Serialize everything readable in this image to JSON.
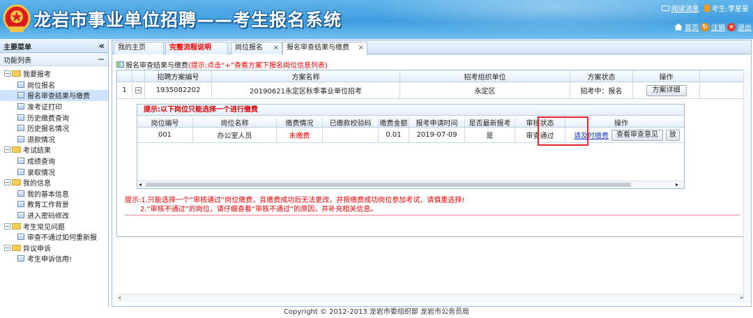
{
  "header": {
    "title": "龙岩市事业单位招聘——考生报名系统",
    "read_msg": "阅读消息",
    "candidate_label": "考生:李星星",
    "home": "首页",
    "logout": "注销",
    "exit": "退出"
  },
  "sidebar": {
    "main_menu": "主要菜单",
    "collapse_glyph": "«",
    "func_list": "功能列表",
    "minus_glyph": "−",
    "groups": [
      {
        "label": "我要报考",
        "items": [
          "岗位报名",
          "报名审查结果与缴费",
          "准考证打印",
          "历史缴费查询",
          "历史报名情况",
          "退款情况"
        ]
      },
      {
        "label": "考试结果",
        "items": [
          "成绩查询",
          "录取情况"
        ]
      },
      {
        "label": "我的信息",
        "items": [
          "我的基本信息",
          "教育工作背景",
          "进入密码修改"
        ]
      },
      {
        "label": "考生常见问题",
        "items": [
          "审查不通过如何重新报"
        ]
      },
      {
        "label": "异议申诉",
        "items": [
          "考生申诉信用!"
        ]
      }
    ]
  },
  "tabs": [
    {
      "label": "我的主页",
      "closable": false
    },
    {
      "label": "完整流程说明",
      "closable": false
    },
    {
      "label": "岗位报名",
      "closable": true
    },
    {
      "label": "报名审查结果与缴费",
      "closable": true
    }
  ],
  "panel": {
    "title": "报名审查结果与缴费",
    "hint": "(提示:点击“+”查看方案下报名岗位信息列表)"
  },
  "grid": {
    "columns": [
      "招聘方案编号",
      "方案名称",
      "招考组织单位",
      "方案状态",
      "操作"
    ],
    "row": {
      "index": "1",
      "expand_glyph": "−",
      "code": "1935082202",
      "name": "20190621永定区秋季事业单位招考",
      "org": "永定区",
      "status": "招考中：报名",
      "action": "方案详细"
    }
  },
  "subgrid": {
    "title": "提示:以下岗位只能选择一个进行缴费",
    "columns": [
      "岗位编号",
      "岗位名称",
      "缴费情况",
      "已缴款校验码",
      "缴费金额",
      "报考申请时间",
      "是否最新报考",
      "审核状态",
      "操作"
    ],
    "row": {
      "post_code": "001",
      "post_name": "办公室人员",
      "pay_status": "未缴费",
      "verify_code": "",
      "amount": "0.01",
      "apply_time": "2019-07-09",
      "is_latest": "是",
      "audit": "审查通过",
      "pay_link": "请及时缴费",
      "view_btn": "查看审查意见",
      "more_btn": "放"
    }
  },
  "notes": {
    "line1": "提示:1.只能选择一个“审核通过”岗位缴费，且缴费成功后无法更改，并按缴费成功岗位参加考试，请慎重选择!",
    "line2": "2.“审核不通过”的岗位，请仔细查看“审核不通过”的原因，并补充相关信息。"
  },
  "footer": "Copyright © 2012-2013 龙岩市委组织部 龙岩市公务员局",
  "colors": {
    "accent": "#3f9ddf",
    "red": "#e00000",
    "highlight": "#e8262b"
  }
}
